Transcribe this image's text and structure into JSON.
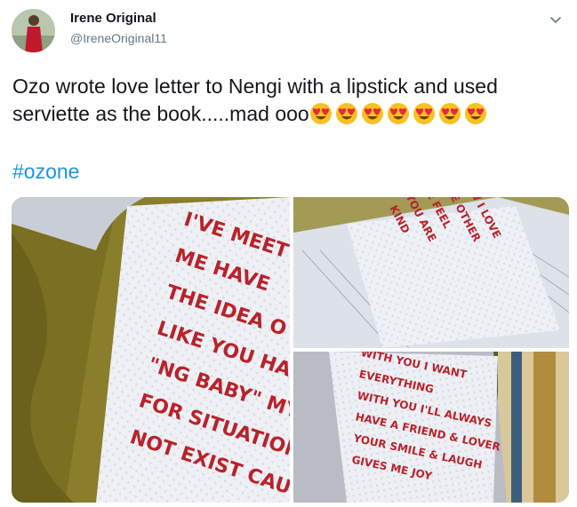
{
  "user": {
    "name": "Irene Original",
    "handle": "@IreneOriginal11"
  },
  "tweet": {
    "text": "Ozo wrote love letter to Nengi with a lipstick and used serviette as the book.....mad ooo",
    "emoji": "heart-eyes-emoji",
    "emoji_count": 7,
    "hashtag": "#ozone"
  },
  "photos": [
    {
      "lines": [
        "I'VE MEET",
        "ME HAVE",
        "THE IDEA O",
        "LIKE YOU HA",
        "\"NG BABY\" MY",
        "FOR SITUATIONS",
        "NOT EXIST CAUSE"
      ]
    },
    {
      "lines": [
        "I KNOW I LOVE",
        "NONE OTHER",
        "ME FEEL",
        "YOU ARE",
        "KIND"
      ]
    },
    {
      "lines": [
        "WITH YOU I WANT",
        "EVERYTHING",
        "WITH YOU I'LL ALWAYS",
        "HAVE A FRIEND & LOVER",
        "YOUR SMILE & LAUGH",
        "GIVES ME JOY"
      ]
    }
  ],
  "colors": {
    "text": "#14171a",
    "secondary": "#657786",
    "link": "#1b95e0",
    "lipstick": "#b8232b",
    "emoji_face": "#f7c221",
    "emoji_heart": "#e8283d"
  }
}
